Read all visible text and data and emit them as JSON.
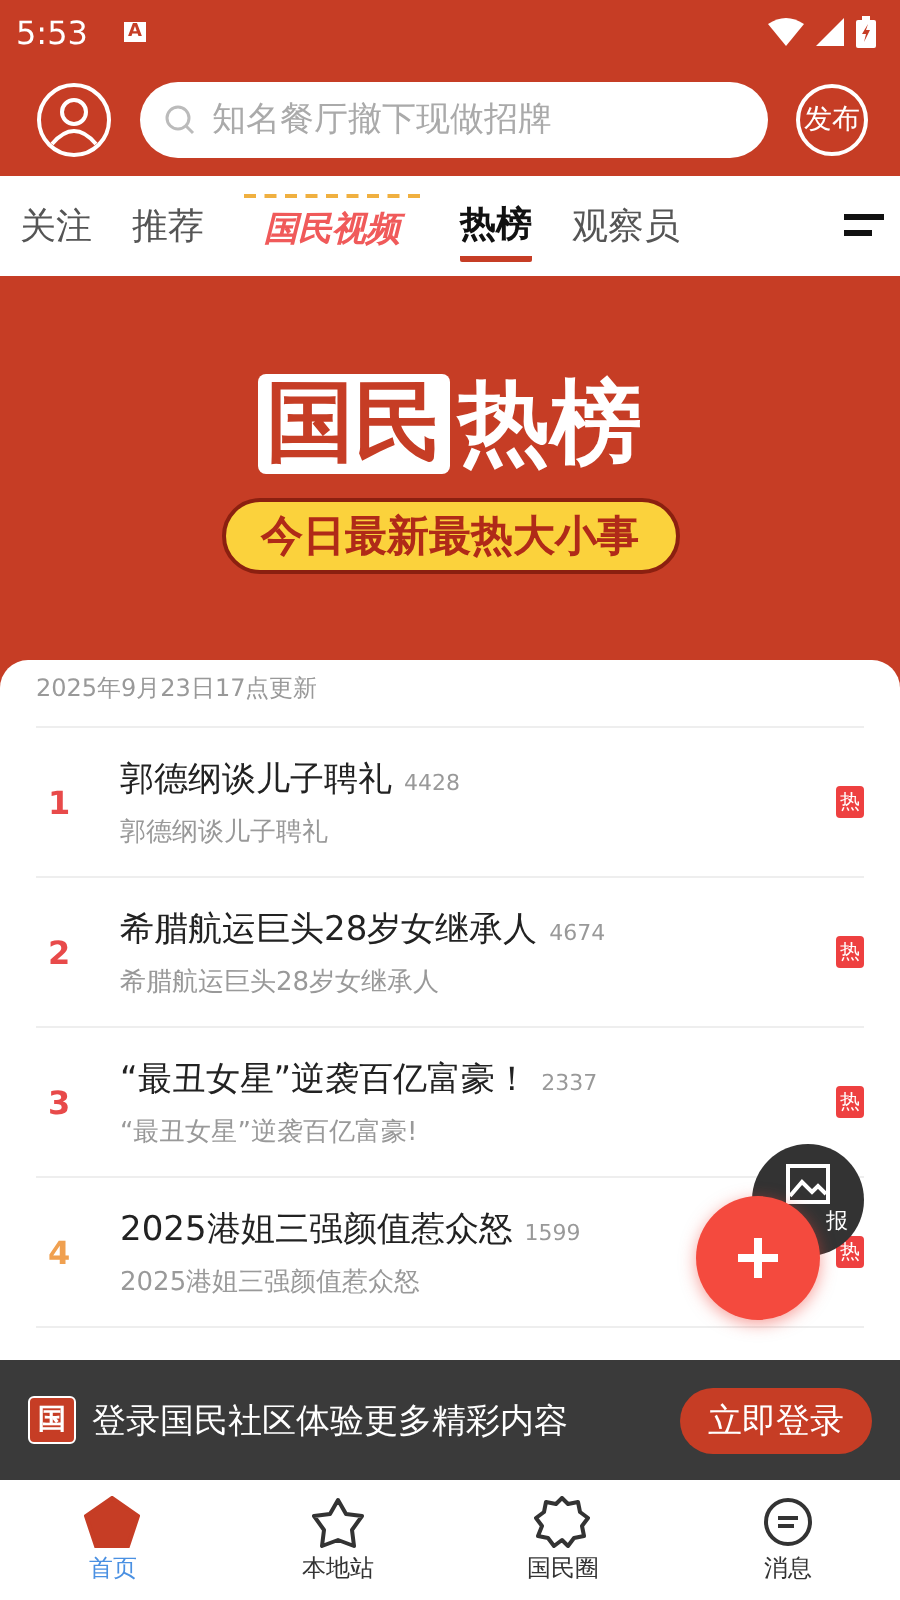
{
  "status_bar": {
    "time": "5:53",
    "notification_icon": "A"
  },
  "header": {
    "search": {
      "placeholder": "知名餐厅撤下现做招牌"
    },
    "publish_button": "发布"
  },
  "tabs": [
    {
      "label": "关注",
      "kind": "text",
      "selected": false
    },
    {
      "label": "推荐",
      "kind": "text",
      "selected": false
    },
    {
      "label": "国民视频",
      "kind": "logo",
      "selected": false
    },
    {
      "label": "热榜",
      "kind": "text",
      "selected": true
    },
    {
      "label": "观察员",
      "kind": "text",
      "selected": false
    }
  ],
  "hero": {
    "title_boxed": "国民",
    "title": "热榜",
    "tagline": "今日最新最热大小事"
  },
  "hot_list": {
    "updated": "2025年9月23日17点更新",
    "rows": [
      {
        "rank": "1",
        "title": "郭德纲谈儿子聘礼",
        "count": "4428",
        "subtitle": "郭德纲谈儿子聘礼",
        "badge": "热",
        "color": "#e84a4a"
      },
      {
        "rank": "2",
        "title": "希腊航运巨头28岁女继承人",
        "count": "4674",
        "subtitle": "希腊航运巨头28岁女继承人",
        "badge": "热",
        "color": "#e84a4a"
      },
      {
        "rank": "3",
        "title": "“最丑女星”逆袭百亿富豪！",
        "count": "2337",
        "subtitle": "“最丑女星”逆袭百亿富豪!",
        "badge": "热",
        "color": "#e84a4a"
      },
      {
        "rank": "4",
        "title": "2025港姐三强颜值惹众怒",
        "count": "1599",
        "subtitle": "2025港姐三强颜值惹众怒",
        "badge": "热",
        "color": "#f0a050"
      }
    ]
  },
  "poster_button": {
    "label": "报"
  },
  "login_banner": {
    "logo": "国",
    "text": "登录国民社区体验更多精彩内容",
    "button": "立即登录"
  },
  "bottom_nav": [
    {
      "label": "首页",
      "selected": true
    },
    {
      "label": "本地站",
      "selected": false
    },
    {
      "label": "国民圈",
      "selected": false
    },
    {
      "label": "消息",
      "selected": false
    }
  ]
}
